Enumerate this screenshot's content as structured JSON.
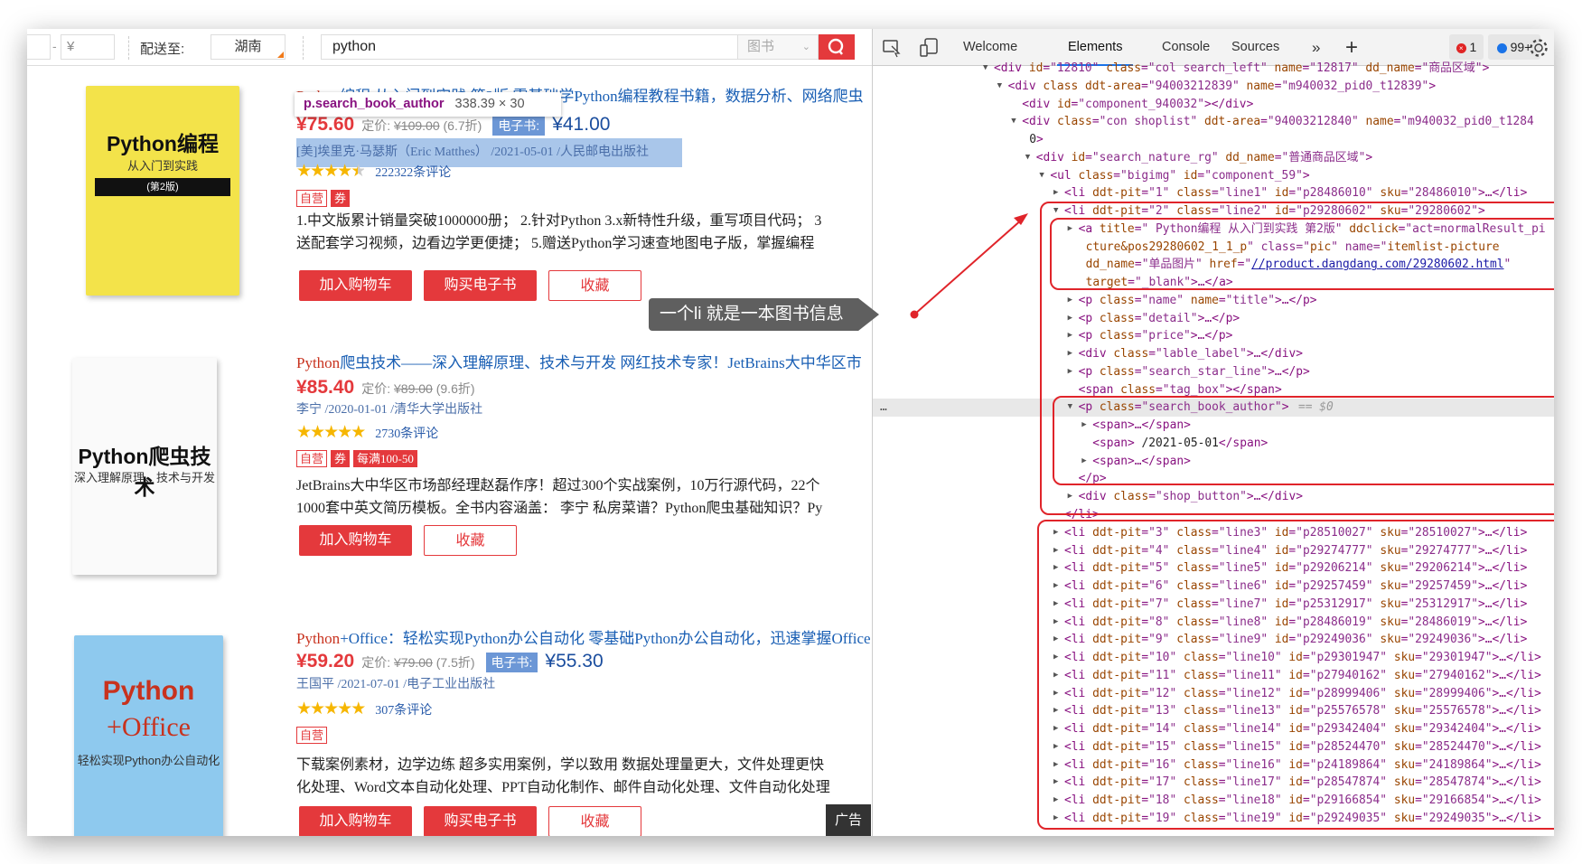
{
  "toolbar": {
    "price_symbol": "¥",
    "dash": "-",
    "ship_label": "配送至:",
    "region": "湖南",
    "search_value": "python",
    "category": "图书",
    "search_icon": "search-icon"
  },
  "inspect_tooltip": {
    "selector": "p.search_book_author",
    "size": "338.39 × 30"
  },
  "books": [
    {
      "title_hl": "Python",
      "title": "编程 从入门到实践 第2版 零基础学Python编程教程书籍，数据分析、网络爬虫",
      "price": "¥75.60",
      "orig_label": "定价:",
      "orig": "¥109.00",
      "discount": "(6.7折)",
      "ebook_label": "电子书:",
      "ebook_price": "¥41.00",
      "author": "[美]埃里克·马瑟斯（Eric Matthes） /2021-05-01 /人民邮电出版社",
      "rating": 4.5,
      "reviews": "222322条评论",
      "tags": [
        "自营",
        "券"
      ],
      "desc": [
        "1.中文版累计销量突破1000000册； 2.针对Python 3.x新特性升级，重写项目代码； 3",
        "送配套学习视频，边看边学更便捷； 5.赠送Python学习速查地图电子版，掌握编程"
      ],
      "buttons": [
        "加入购物车",
        "购买电子书",
        "收藏"
      ],
      "cover": {
        "main": "Python编程",
        "sub": "从入门到实践",
        "ed": "(第2版)"
      }
    },
    {
      "title_hl": "Python",
      "title": "爬虫技术——深入理解原理、技术与开发 网红技术专家！JetBrains大中华区市",
      "price": "¥85.40",
      "orig_label": "定价:",
      "orig": "¥89.00",
      "discount": "(9.6折)",
      "author": "李宁 /2020-01-01 /清华大学出版社",
      "rating": 5,
      "reviews": "2730条评论",
      "tags": [
        "自营",
        "券",
        "每满100-50"
      ],
      "desc": [
        "JetBrains大中华区市场部经理赵磊作序！超过300个实战案例，10万行源代码，22个",
        "1000套中英文简历模板。全书内容涵盖： 李宁 私房菜谱？Python爬虫基础知识？Py"
      ],
      "buttons": [
        "加入购物车",
        "收藏"
      ],
      "cover": {
        "main": "Python爬虫技术",
        "sub": "深入理解原理、技术与开发"
      }
    },
    {
      "title_hl": "Python",
      "title": "+Office：轻松实现Python办公自动化 零基础Python办公自动化，迅速掌握Office",
      "price": "¥59.20",
      "orig_label": "定价:",
      "orig": "¥79.00",
      "discount": "(7.5折)",
      "ebook_label": "电子书:",
      "ebook_price": "¥55.30",
      "author": "王国平 /2021-07-01 /电子工业出版社",
      "rating": 5,
      "reviews": "307条评论",
      "tags": [
        "自营"
      ],
      "desc": [
        "下载案例素材，边学边练 超多实用案例，学以致用 数据处理量更大，文件处理更快",
        "化处理、Word文本自动化处理、PPT自动化制作、邮件自动化处理、文件自动化处理"
      ],
      "buttons": [
        "加入购物车",
        "购买电子书",
        "收藏"
      ],
      "cover": {
        "main": "Python",
        "main2": "+Office",
        "sub": "轻松实现Python办公自动化"
      }
    }
  ],
  "ad_label": "广告",
  "annotation": "一个li 就是一本图书信息",
  "devtools": {
    "tabs": [
      "Welcome",
      "Elements",
      "Console",
      "Sources"
    ],
    "active_tab": "Elements",
    "more": "»",
    "add": "+",
    "errors": "1",
    "messages": "99+",
    "ellipsis": "…",
    "selected_suffix": "== $0",
    "lines": [
      {
        "l": 0,
        "t": "open",
        "s": "<div id=\"12810\" class=\"col search_left\" name=\"12817\" dd_name=\"商品区域\">"
      },
      {
        "l": 1,
        "t": "open",
        "s": "<div class ddt-area=\"94003212839\" name=\"m940032_pid0_t12839\">"
      },
      {
        "l": 2,
        "t": "none",
        "s": "<div id=\"component_940032\"></div>"
      },
      {
        "l": 2,
        "t": "open",
        "s": "<div class=\"con shoplist\" ddt-area=\"94003212840\" name=\"m940032_pid0_t1284"
      },
      {
        "l": 2,
        "t": "cont",
        "s": "0\">"
      },
      {
        "l": 3,
        "t": "open",
        "s": "<div id=\"search_nature_rg\" dd_name=\"普通商品区域\">"
      },
      {
        "l": 4,
        "t": "open",
        "s": "<ul class=\"bigimg\" id=\"component_59\">"
      },
      {
        "l": 5,
        "t": "closed",
        "s": "<li ddt-pit=\"1\" class=\"line1\" id=\"p28486010\" sku=\"28486010\">…</li>"
      },
      {
        "l": 5,
        "t": "open",
        "s": "<li ddt-pit=\"2\" class=\"line2\" id=\"p29280602\" sku=\"29280602\">"
      },
      {
        "l": 6,
        "t": "closed",
        "s": "<a title=\" Python编程 从入门到实践 第2版\" ddclick=\"act=normalResult_pi"
      },
      {
        "l": 6,
        "t": "cont",
        "s": "cture&pos=29280602_1_1_p\" class=\"pic\" name=\"itemlist-picture\""
      },
      {
        "l": 6,
        "t": "cont",
        "s": "dd_name=\"单品图片\" href=\"//product.dangdang.com/29280602.html\""
      },
      {
        "l": 6,
        "t": "cont",
        "s": "target=\"_blank\">…</a>"
      },
      {
        "l": 6,
        "t": "closed",
        "s": "<p class=\"name\" name=\"title\">…</p>"
      },
      {
        "l": 6,
        "t": "closed",
        "s": "<p class=\"detail\">…</p>"
      },
      {
        "l": 6,
        "t": "closed",
        "s": "<p class=\"price\">…</p>"
      },
      {
        "l": 6,
        "t": "closed",
        "s": "<div class=\"lable_label\">…</div>"
      },
      {
        "l": 6,
        "t": "closed",
        "s": "<p class=\"search_star_line\">…</p>"
      },
      {
        "l": 6,
        "t": "none",
        "s": "<span class=\"tag_box\"></span>"
      },
      {
        "l": 6,
        "t": "open",
        "s": "<p class=\"search_book_author\">",
        "sel": true
      },
      {
        "l": 7,
        "t": "closed",
        "s": "<span>…</span>"
      },
      {
        "l": 7,
        "t": "none",
        "s": "<span> /2021-05-01</span>"
      },
      {
        "l": 7,
        "t": "closed",
        "s": "<span>…</span>"
      },
      {
        "l": 6,
        "t": "none",
        "s": "</p>"
      },
      {
        "l": 6,
        "t": "closed",
        "s": "<div class=\"shop_button\">…</div>"
      },
      {
        "l": 5,
        "t": "none",
        "s": "</li>"
      },
      {
        "l": 5,
        "t": "closed",
        "s": "<li ddt-pit=\"3\" class=\"line3\" id=\"p28510027\" sku=\"28510027\">…</li>"
      },
      {
        "l": 5,
        "t": "closed",
        "s": "<li ddt-pit=\"4\" class=\"line4\" id=\"p29274777\" sku=\"29274777\">…</li>"
      },
      {
        "l": 5,
        "t": "closed",
        "s": "<li ddt-pit=\"5\" class=\"line5\" id=\"p29206214\" sku=\"29206214\">…</li>"
      },
      {
        "l": 5,
        "t": "closed",
        "s": "<li ddt-pit=\"6\" class=\"line6\" id=\"p29257459\" sku=\"29257459\">…</li>"
      },
      {
        "l": 5,
        "t": "closed",
        "s": "<li ddt-pit=\"7\" class=\"line7\" id=\"p25312917\" sku=\"25312917\">…</li>"
      },
      {
        "l": 5,
        "t": "closed",
        "s": "<li ddt-pit=\"8\" class=\"line8\" id=\"p28486019\" sku=\"28486019\">…</li>"
      },
      {
        "l": 5,
        "t": "closed",
        "s": "<li ddt-pit=\"9\" class=\"line9\" id=\"p29249036\" sku=\"29249036\">…</li>"
      },
      {
        "l": 5,
        "t": "closed",
        "s": "<li ddt-pit=\"10\" class=\"line10\" id=\"p29301947\" sku=\"29301947\">…</li>"
      },
      {
        "l": 5,
        "t": "closed",
        "s": "<li ddt-pit=\"11\" class=\"line11\" id=\"p27940162\" sku=\"27940162\">…</li>"
      },
      {
        "l": 5,
        "t": "closed",
        "s": "<li ddt-pit=\"12\" class=\"line12\" id=\"p28999406\" sku=\"28999406\">…</li>"
      },
      {
        "l": 5,
        "t": "closed",
        "s": "<li ddt-pit=\"13\" class=\"line13\" id=\"p25576578\" sku=\"25576578\">…</li>"
      },
      {
        "l": 5,
        "t": "closed",
        "s": "<li ddt-pit=\"14\" class=\"line14\" id=\"p29342404\" sku=\"29342404\">…</li>"
      },
      {
        "l": 5,
        "t": "closed",
        "s": "<li ddt-pit=\"15\" class=\"line15\" id=\"p28524470\" sku=\"28524470\">…</li>"
      },
      {
        "l": 5,
        "t": "closed",
        "s": "<li ddt-pit=\"16\" class=\"line16\" id=\"p24189864\" sku=\"24189864\">…</li>"
      },
      {
        "l": 5,
        "t": "closed",
        "s": "<li ddt-pit=\"17\" class=\"line17\" id=\"p28547874\" sku=\"28547874\">…</li>"
      },
      {
        "l": 5,
        "t": "closed",
        "s": "<li ddt-pit=\"18\" class=\"line18\" id=\"p29166854\" sku=\"29166854\">…</li>"
      },
      {
        "l": 5,
        "t": "closed",
        "s": "<li ddt-pit=\"19\" class=\"line19\" id=\"p29249035\" sku=\"29249035\">…</li>"
      }
    ]
  },
  "colors": {
    "accent_red": "#e4393c",
    "link_blue": "#1a5fb4",
    "highlight_box": "#e0242a",
    "devtools_tab": "#1a73e8"
  }
}
